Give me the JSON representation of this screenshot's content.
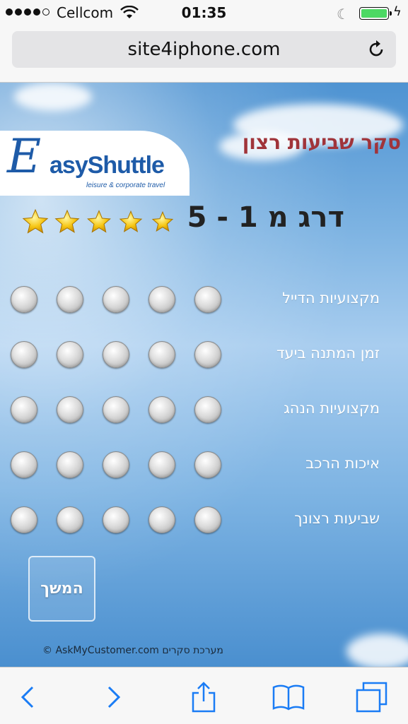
{
  "status_bar": {
    "carrier": "Cellcom",
    "time": "01:35",
    "battery_color": "#4cd964",
    "icons": [
      "signal-dots",
      "wifi-icon",
      "moon-icon",
      "battery-icon",
      "charging-bolt-icon"
    ]
  },
  "browser": {
    "url": "site4iphone.com",
    "icons": [
      "reload-icon",
      "back-icon",
      "forward-icon",
      "share-icon",
      "bookmarks-icon",
      "tabs-icon"
    ]
  },
  "page": {
    "title": "סקר שביעות רצון",
    "logo": {
      "text": "EasyShuttle",
      "sub": "leisure & corporate travel"
    },
    "scale_label": "דרג מ 1 - 5",
    "stars_shown": 5,
    "questions": [
      {
        "label": "מקצועיות הדייל"
      },
      {
        "label": "זמן המתנה ביעד"
      },
      {
        "label": "מקצועיות הנהג"
      },
      {
        "label": "איכות הרכב"
      },
      {
        "label": "שביעות רצונך"
      }
    ],
    "options_per_question": 5,
    "next_button": "המשך",
    "footer": "© AskMyCustomer.com מערכת סקרים"
  },
  "colors": {
    "title": "#a0343a",
    "brand": "#1e5ba8",
    "ios_blue": "#1a7cf5"
  }
}
